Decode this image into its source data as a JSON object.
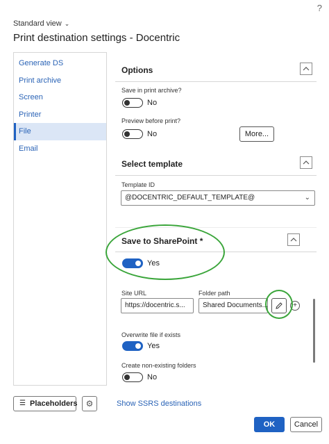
{
  "header": {
    "help": "?",
    "view_label": "Standard view",
    "title": "Print destination settings - Docentric"
  },
  "sidebar": {
    "items": [
      {
        "label": "Generate DS"
      },
      {
        "label": "Print archive"
      },
      {
        "label": "Screen"
      },
      {
        "label": "Printer"
      },
      {
        "label": "File"
      },
      {
        "label": "Email"
      }
    ],
    "selected": "File"
  },
  "options": {
    "title": "Options",
    "save_in_print_archive": {
      "label": "Save in print archive?",
      "value": "No"
    },
    "preview_before_print": {
      "label": "Preview before print?",
      "value": "No"
    },
    "more_button": "More..."
  },
  "select_template": {
    "title": "Select template",
    "template_id_label": "Template ID",
    "template_id_value": "@DOCENTRIC_DEFAULT_TEMPLATE@"
  },
  "sharepoint": {
    "title": "Save to SharePoint *",
    "toggle_value": "Yes",
    "site_url_label": "Site URL",
    "site_url_value": "https://docentric.s...",
    "folder_path_label": "Folder path",
    "folder_path_value": "Shared Documents...",
    "overwrite": {
      "label": "Overwrite file if exists",
      "value": "Yes"
    },
    "create_folders": {
      "label": "Create non-existing folders",
      "value": "No"
    }
  },
  "footer": {
    "placeholders_button": "Placeholders",
    "show_ssrs_link": "Show SSRS destinations",
    "ok_button": "OK",
    "cancel_button": "Cancel"
  },
  "colors": {
    "accent": "#1f62c3",
    "annotation": "#3aa53a",
    "link": "#2a63b6"
  }
}
